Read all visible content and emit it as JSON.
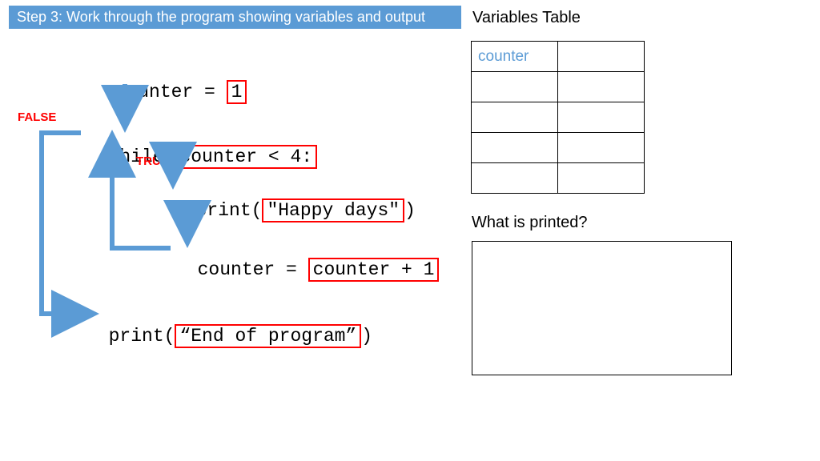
{
  "banner": "Step 3: Work through the program showing variables and output",
  "code": {
    "assign_var": "counter = ",
    "assign_val": "1",
    "while_kw": "while ",
    "while_cond": "counter < 4:",
    "print1_pre": "print(",
    "print1_arg": "\"Happy days\"",
    "print1_post": ")",
    "incr_pre": "counter = ",
    "incr_val": "counter + 1",
    "print2_pre": "print(",
    "print2_arg": "“End of program”",
    "print2_post": ")"
  },
  "labels": {
    "false": "FALSE",
    "true": "TRUE",
    "vars_table": "Variables Table",
    "printed": "What is printed?"
  },
  "vars_table": {
    "counter_header": "counter"
  }
}
